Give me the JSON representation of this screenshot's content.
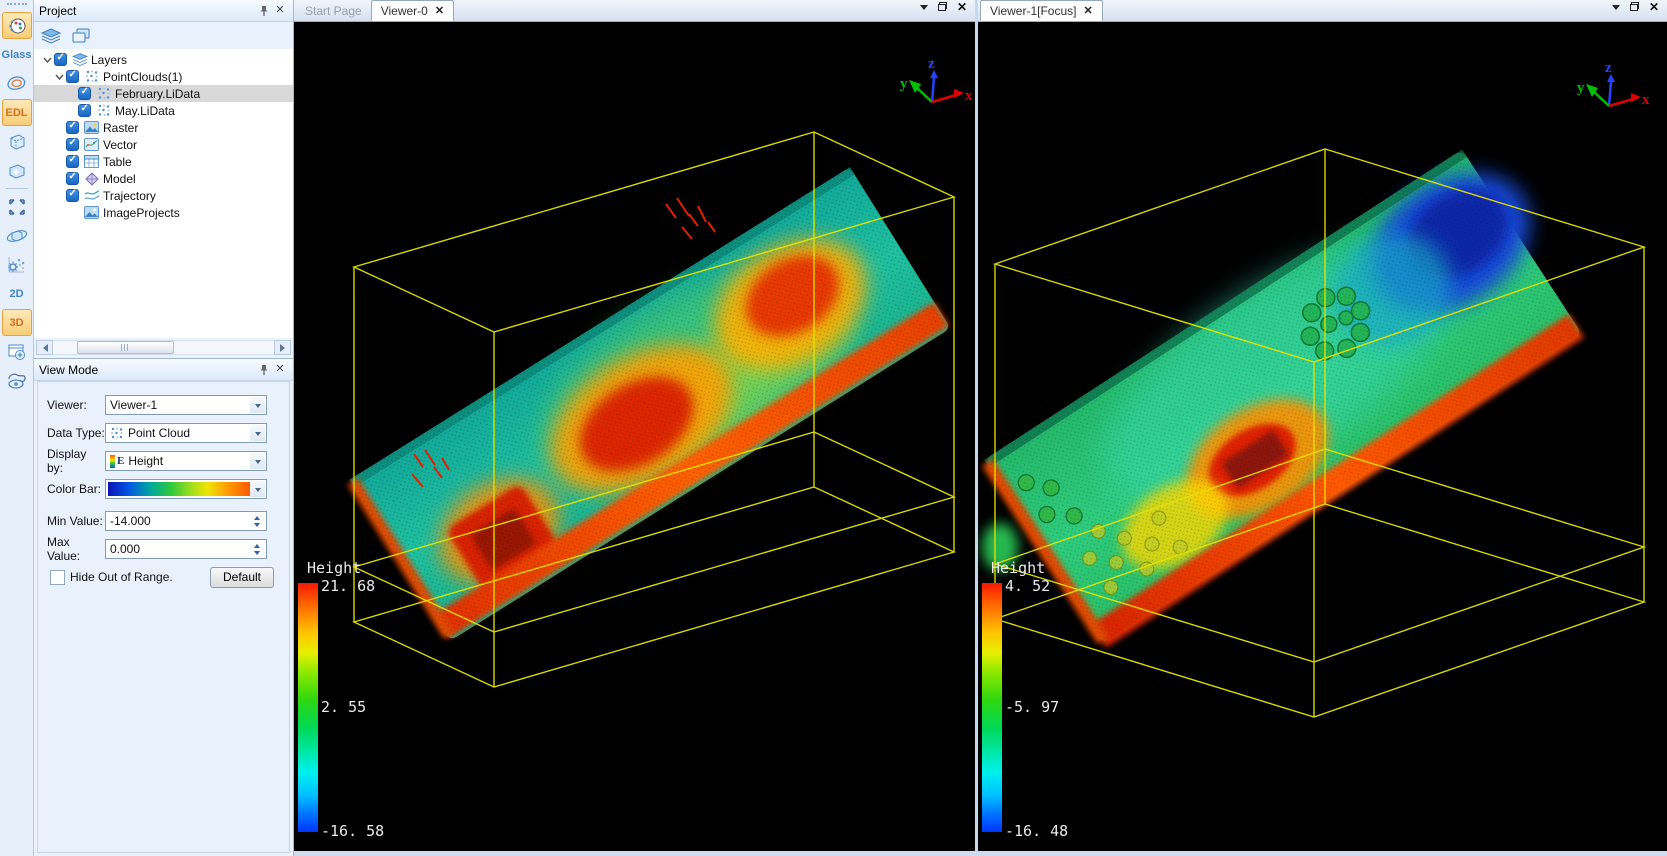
{
  "left_toolbar": {
    "items": [
      {
        "name": "palette",
        "label": "",
        "selected": true
      },
      {
        "name": "glass",
        "label": "Glass",
        "selected": false
      },
      {
        "name": "contour",
        "label": "",
        "selected": false
      },
      {
        "name": "edl",
        "label": "EDL",
        "selected": true
      },
      {
        "name": "cube-dashed",
        "label": "",
        "selected": false
      },
      {
        "name": "cube-sparkle",
        "label": "",
        "selected": false
      },
      {
        "name": "expand-arrows",
        "label": "",
        "selected": false
      },
      {
        "name": "orbit",
        "label": "",
        "selected": false
      },
      {
        "name": "cloud-settings",
        "label": "",
        "selected": false
      },
      {
        "name": "2d",
        "label": "2D",
        "selected": false
      },
      {
        "name": "3d",
        "label": "3D",
        "selected": true
      },
      {
        "name": "window-add",
        "label": "",
        "selected": false
      },
      {
        "name": "profile-eye",
        "label": "",
        "selected": false
      }
    ]
  },
  "icons": {
    "close": "✕"
  },
  "project_panel": {
    "title": "Project",
    "tree": [
      {
        "label": "Layers",
        "level": 0,
        "expanded": true,
        "checked": true,
        "icon": "layers"
      },
      {
        "label": "PointClouds(1)",
        "level": 1,
        "expanded": true,
        "checked": true,
        "icon": "pointcloud"
      },
      {
        "label": "February.LiData",
        "level": 2,
        "checked": true,
        "icon": "pointcloud",
        "selected": true
      },
      {
        "label": "May.LiData",
        "level": 2,
        "checked": true,
        "icon": "pointcloud"
      },
      {
        "label": "Raster",
        "level": 1,
        "checked": true,
        "icon": "raster"
      },
      {
        "label": "Vector",
        "level": 1,
        "checked": true,
        "icon": "vector"
      },
      {
        "label": "Table",
        "level": 1,
        "checked": true,
        "icon": "table"
      },
      {
        "label": "Model",
        "level": 1,
        "checked": true,
        "icon": "model"
      },
      {
        "label": "Trajectory",
        "level": 1,
        "checked": true,
        "icon": "trajectory"
      },
      {
        "label": "ImageProjects",
        "level": 1,
        "checked": null,
        "icon": "image"
      }
    ]
  },
  "view_mode": {
    "title": "View Mode",
    "viewer_label": "Viewer:",
    "viewer_value": "Viewer-1",
    "data_type_label": "Data Type:",
    "data_type_value": "Point Cloud",
    "display_by_label": "Display by:",
    "display_by_value": "Height",
    "display_icon_letter": "E",
    "color_bar_label": "Color Bar:",
    "min_label": "Min Value:",
    "min_value": "-14.000",
    "max_label": "Max Value:",
    "max_value": "0.000",
    "hide_label": "Hide Out of Range.",
    "default_button": "Default",
    "colorbar_left_color": "#0a14b4",
    "colorbar_right_color": "#ff5a00"
  },
  "viewer0": {
    "tabs": [
      {
        "label": "Start Page",
        "active": false
      },
      {
        "label": "Viewer-0",
        "active": true
      }
    ],
    "legend": {
      "title": "Height",
      "max": "21. 68",
      "mid": "2. 55",
      "min": "-16. 58"
    },
    "axis": {
      "x": "x",
      "y": "y",
      "z": "z"
    }
  },
  "viewer1": {
    "tabs": [
      {
        "label": "Viewer-1[Focus]",
        "active": true
      }
    ],
    "legend": {
      "title": "Height",
      "max": "4. 52",
      "mid": "-5. 97",
      "min": "-16. 48"
    },
    "axis": {
      "x": "x",
      "y": "y",
      "z": "z"
    }
  },
  "colors": {
    "selection_orange": "#f8cd77",
    "checkbox_blue": "#1a67c2",
    "wireframe_yellow": "#e6e200",
    "viewport_background": "#000000",
    "legend_top": "#f81800",
    "legend_bottom": "#0034ff"
  }
}
